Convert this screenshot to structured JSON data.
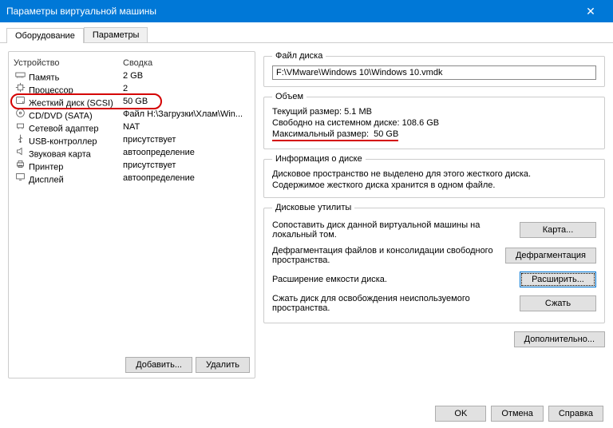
{
  "window": {
    "title": "Параметры виртуальной машины"
  },
  "tabs": {
    "hardware": "Оборудование",
    "options": "Параметры"
  },
  "deviceList": {
    "header": {
      "device": "Устройство",
      "summary": "Сводка"
    },
    "items": [
      {
        "icon": "memory",
        "name": "Память",
        "summary": "2 GB"
      },
      {
        "icon": "cpu",
        "name": "Процессор",
        "summary": "2"
      },
      {
        "icon": "hdd",
        "name": "Жесткий диск (SCSI)",
        "summary": "50 GB"
      },
      {
        "icon": "cd",
        "name": "CD/DVD (SATA)",
        "summary": "Файл H:\\Загрузки\\Хлам\\Win..."
      },
      {
        "icon": "net",
        "name": "Сетевой адаптер",
        "summary": "NAT"
      },
      {
        "icon": "usb",
        "name": "USB-контроллер",
        "summary": "присутствует"
      },
      {
        "icon": "sound",
        "name": "Звуковая карта",
        "summary": "автоопределение"
      },
      {
        "icon": "printer",
        "name": "Принтер",
        "summary": "присутствует"
      },
      {
        "icon": "display",
        "name": "Дисплей",
        "summary": "автоопределение"
      }
    ]
  },
  "leftButtons": {
    "add": "Добавить...",
    "remove": "Удалить"
  },
  "diskFile": {
    "legend": "Файл диска",
    "path": "F:\\VMware\\Windows 10\\Windows 10.vmdk"
  },
  "capacity": {
    "legend": "Объем",
    "currentLabel": "Текущий размер:",
    "currentValue": "5.1 MB",
    "freeLabel": "Свободно на системном диске:",
    "freeValue": "108.6 GB",
    "maxLabel": "Максимальный размер:",
    "maxValue": "50 GB"
  },
  "diskInfo": {
    "legend": "Информация о диске",
    "line1": "Дисковое пространство не выделено для этого жесткого диска.",
    "line2": "Содержимое жесткого диска хранится в одном файле."
  },
  "utilities": {
    "legend": "Дисковые утилиты",
    "map": {
      "text": "Сопоставить диск данной виртуальной машины на локальный том.",
      "button": "Карта..."
    },
    "defrag": {
      "text": "Дефрагментация файлов и консолидации свободного пространства.",
      "button": "Дефрагментация"
    },
    "expand": {
      "text": "Расширение емкости диска.",
      "button": "Расширить..."
    },
    "compact": {
      "text": "Сжать диск для освобождения неиспользуемого пространства.",
      "button": "Сжать"
    }
  },
  "advanced": "Дополнительно...",
  "footer": {
    "ok": "OK",
    "cancel": "Отмена",
    "help": "Справка"
  }
}
